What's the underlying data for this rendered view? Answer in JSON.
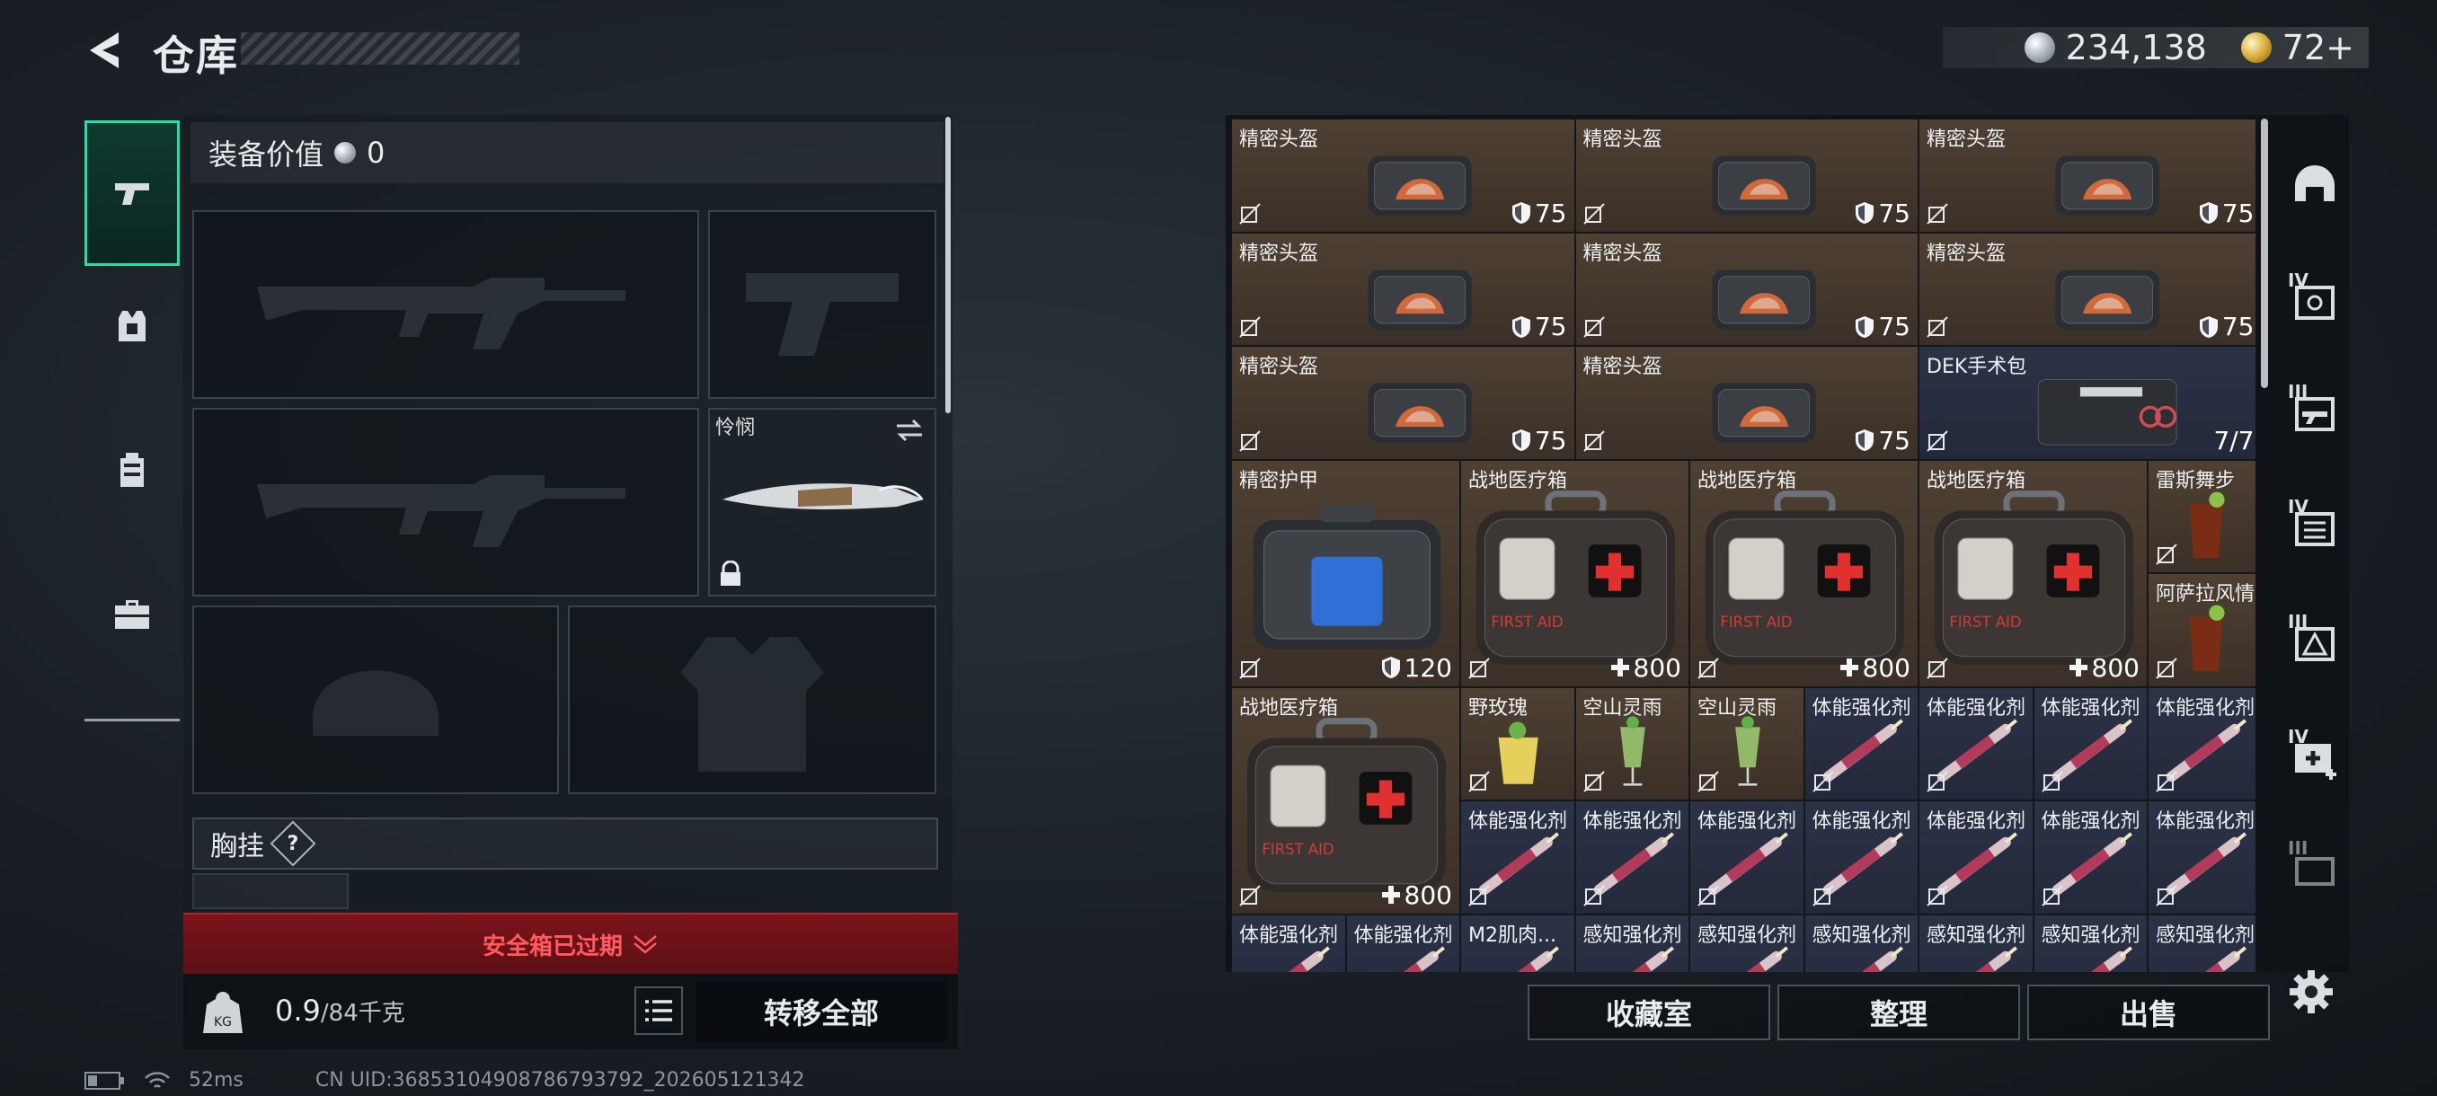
{
  "header": {
    "title": "仓库",
    "silver": "234,138",
    "gold": "72+"
  },
  "equipment": {
    "value_label": "装备价值",
    "value": "0",
    "melee_name": "怜悯",
    "chest_label": "胸挂",
    "help": "?",
    "safebox_text": "安全箱已过期",
    "weight_current": "0.9",
    "weight_max": "/84千克",
    "transfer_label": "转移全部"
  },
  "inventory": {
    "items": [
      {
        "name": "精密头盔",
        "value": "75",
        "kind": "shield"
      },
      {
        "name": "精密头盔",
        "value": "75",
        "kind": "shield"
      },
      {
        "name": "精密头盔",
        "value": "75",
        "kind": "shield"
      },
      {
        "name": "精密头盔",
        "value": "75",
        "kind": "shield"
      },
      {
        "name": "精密头盔",
        "value": "75",
        "kind": "shield"
      },
      {
        "name": "精密头盔",
        "value": "75",
        "kind": "shield"
      },
      {
        "name": "精密头盔",
        "value": "75",
        "kind": "shield"
      },
      {
        "name": "精密头盔",
        "value": "75",
        "kind": "shield"
      },
      {
        "name": "DEK手术包",
        "value": "7/7",
        "kind": "count"
      },
      {
        "name": "精密护甲",
        "value": "120",
        "kind": "shield"
      },
      {
        "name": "战地医疗箱",
        "value": "800",
        "kind": "heal"
      },
      {
        "name": "战地医疗箱",
        "value": "800",
        "kind": "heal"
      },
      {
        "name": "战地医疗箱",
        "value": "800",
        "kind": "heal"
      },
      {
        "name": "雷斯舞步",
        "value": "",
        "kind": "none"
      },
      {
        "name": "阿萨拉风情",
        "value": "",
        "kind": "none"
      },
      {
        "name": "战地医疗箱",
        "value": "800",
        "kind": "heal"
      },
      {
        "name": "野玫瑰",
        "value": "",
        "kind": "none"
      },
      {
        "name": "空山灵雨",
        "value": "",
        "kind": "none"
      },
      {
        "name": "空山灵雨",
        "value": "",
        "kind": "none"
      },
      {
        "name": "体能强化剂",
        "value": "",
        "kind": "none"
      },
      {
        "name": "体能强化剂",
        "value": "",
        "kind": "none"
      },
      {
        "name": "体能强化剂",
        "value": "",
        "kind": "none"
      },
      {
        "name": "体能强化剂",
        "value": "",
        "kind": "none"
      },
      {
        "name": "体能强化剂",
        "value": "",
        "kind": "none"
      },
      {
        "name": "体能强化剂",
        "value": "",
        "kind": "none"
      },
      {
        "name": "体能强化剂",
        "value": "",
        "kind": "none"
      },
      {
        "name": "体能强化剂",
        "value": "",
        "kind": "none"
      },
      {
        "name": "体能强化剂",
        "value": "",
        "kind": "none"
      },
      {
        "name": "体能强化剂",
        "value": "",
        "kind": "none"
      },
      {
        "name": "体能强化剂",
        "value": "",
        "kind": "none"
      },
      {
        "name": "体能强化剂",
        "value": "",
        "kind": "none"
      },
      {
        "name": "体能强化剂",
        "value": "",
        "kind": "none"
      },
      {
        "name": "M2肌肉...",
        "value": "",
        "kind": "none"
      },
      {
        "name": "感知强化剂",
        "value": "",
        "kind": "none"
      },
      {
        "name": "感知强化剂",
        "value": "",
        "kind": "none"
      },
      {
        "name": "感知强化剂",
        "value": "",
        "kind": "none"
      },
      {
        "name": "感知强化剂",
        "value": "",
        "kind": "none"
      },
      {
        "name": "感知强化剂",
        "value": "",
        "kind": "none"
      },
      {
        "name": "感知强化剂",
        "value": "",
        "kind": "none"
      }
    ]
  },
  "right_tabs": [
    "IV",
    "III",
    "IV",
    "III",
    "IV",
    "III"
  ],
  "buttons": {
    "collection": "收藏室",
    "sort": "整理",
    "sell": "出售"
  },
  "status": {
    "ping": "52ms",
    "uid": "CN UID:3685310490878679379​2_202605121342"
  },
  "colors": {
    "accent": "#23e0a8",
    "alert": "#ff5a5f",
    "brown_cell": "#4e4033",
    "blue_cell": "#2d3347"
  }
}
